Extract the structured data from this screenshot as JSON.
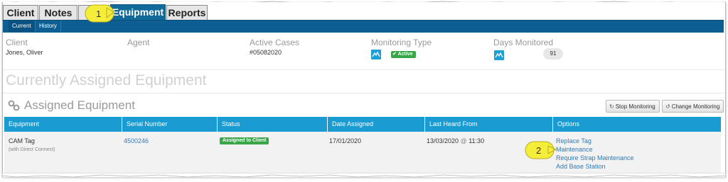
{
  "tabs": [
    {
      "label": "Client"
    },
    {
      "label": "Notes"
    },
    {
      "label": "Equipment"
    },
    {
      "label": "Reports"
    }
  ],
  "subtabs": [
    {
      "label": "Current"
    },
    {
      "label": "History"
    }
  ],
  "summary": {
    "client_label": "Client",
    "client_value": "Jones, Oliver",
    "agent_label": "Agent",
    "active_cases_label": "Active Cases",
    "active_cases_value": "#05082020",
    "monitoring_type_label": "Monitoring Type",
    "monitoring_status": "Active",
    "days_monitored_label": "Days Monitored",
    "days_monitored_value": "91"
  },
  "section_title": "Currently Assigned Equipment",
  "assigned": {
    "title": "Assigned Equipment",
    "stop_button": "Stop Monitoring",
    "change_button": "Change Monitoring"
  },
  "table": {
    "columns": [
      "Equipment",
      "Serial Number",
      "Status",
      "Date Assigned",
      "Last Heard From",
      "Options"
    ],
    "rows": [
      {
        "equipment": "CAM Tag",
        "equipment_note": "(with Direct Connect)",
        "serial": "4500246",
        "status": "Assigned to Client",
        "date_assigned": "17/01/2020",
        "last_heard_date": "13/03/2020",
        "last_heard_at": "@",
        "last_heard_time": "11:30",
        "options": [
          "Replace Tag",
          "Maintenance",
          "Require Strap Maintenance",
          "Add Base Station"
        ]
      }
    ]
  },
  "callouts": [
    "1",
    "2"
  ],
  "colors": {
    "tab_active": "#126a9a",
    "subnav": "#0d5e92",
    "table_header": "#1a9bd2",
    "badge_green": "#3aa64a",
    "link": "#337ab7",
    "callout": "#f4ee3a"
  },
  "icons": [
    "monitoring-device-icon",
    "link-chain-icon",
    "stop-sync-icon",
    "change-sync-icon",
    "check-circle-icon"
  ]
}
